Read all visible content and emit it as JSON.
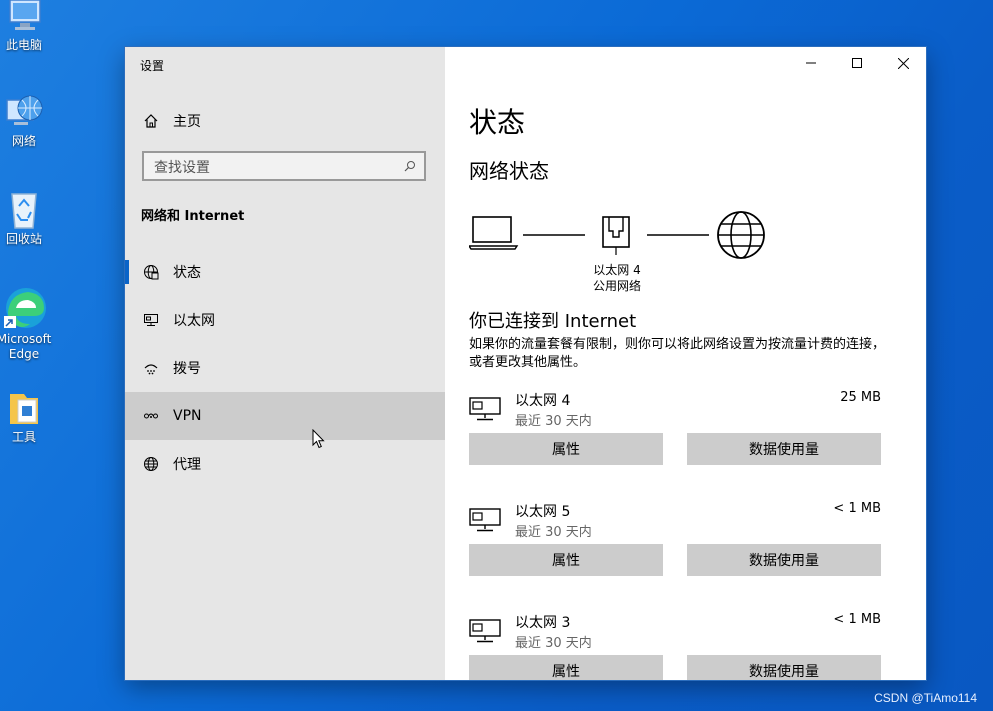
{
  "desktop": {
    "icons": [
      {
        "label": "此电脑",
        "icon": "computer-icon"
      },
      {
        "label": "网络",
        "icon": "network-globe-icon"
      },
      {
        "label": "回收站",
        "icon": "recycle-bin-icon"
      },
      {
        "label": "Microsoft Edge",
        "icon": "edge-icon"
      },
      {
        "label": "工具",
        "icon": "folder-icon"
      }
    ],
    "watermark": "CSDN @TiAmo114"
  },
  "window": {
    "title": "设置",
    "controls": {
      "minimize": "minimize-icon",
      "maximize": "maximize-icon",
      "close": "close-icon"
    }
  },
  "sidebar": {
    "home_label": "主页",
    "search_placeholder": "查找设置",
    "section_title": "网络和 Internet",
    "items": [
      {
        "label": "状态",
        "icon": "status-globe-icon",
        "selected": true
      },
      {
        "label": "以太网",
        "icon": "ethernet-icon"
      },
      {
        "label": "拨号",
        "icon": "dialup-icon"
      },
      {
        "label": "VPN",
        "icon": "vpn-icon",
        "hovered": true
      },
      {
        "label": "代理",
        "icon": "proxy-globe-icon"
      }
    ]
  },
  "main": {
    "title": "状态",
    "network_status_heading": "网络状态",
    "diagram": {
      "adapter_name": "以太网 4",
      "network_type": "公用网络"
    },
    "connected_heading": "你已连接到 Internet",
    "description": "如果你的流量套餐有限制，则你可以将此网络设置为按流量计费的连接，或者更改其他属性。",
    "networks": [
      {
        "name": "以太网 4",
        "period": "最近 30 天内",
        "usage": "25 MB",
        "properties_label": "属性",
        "data_usage_label": "数据使用量"
      },
      {
        "name": "以太网 5",
        "period": "最近 30 天内",
        "usage": "< 1 MB",
        "properties_label": "属性",
        "data_usage_label": "数据使用量"
      },
      {
        "name": "以太网 3",
        "period": "最近 30 天内",
        "usage": "< 1 MB",
        "properties_label": "属性",
        "data_usage_label": "数据使用量"
      }
    ]
  },
  "colors": {
    "accent": "#0a64c8",
    "sidebar_bg": "#e6e6e6",
    "button_bg": "#cccccc",
    "desktop_bg": "#0b6ad6"
  }
}
